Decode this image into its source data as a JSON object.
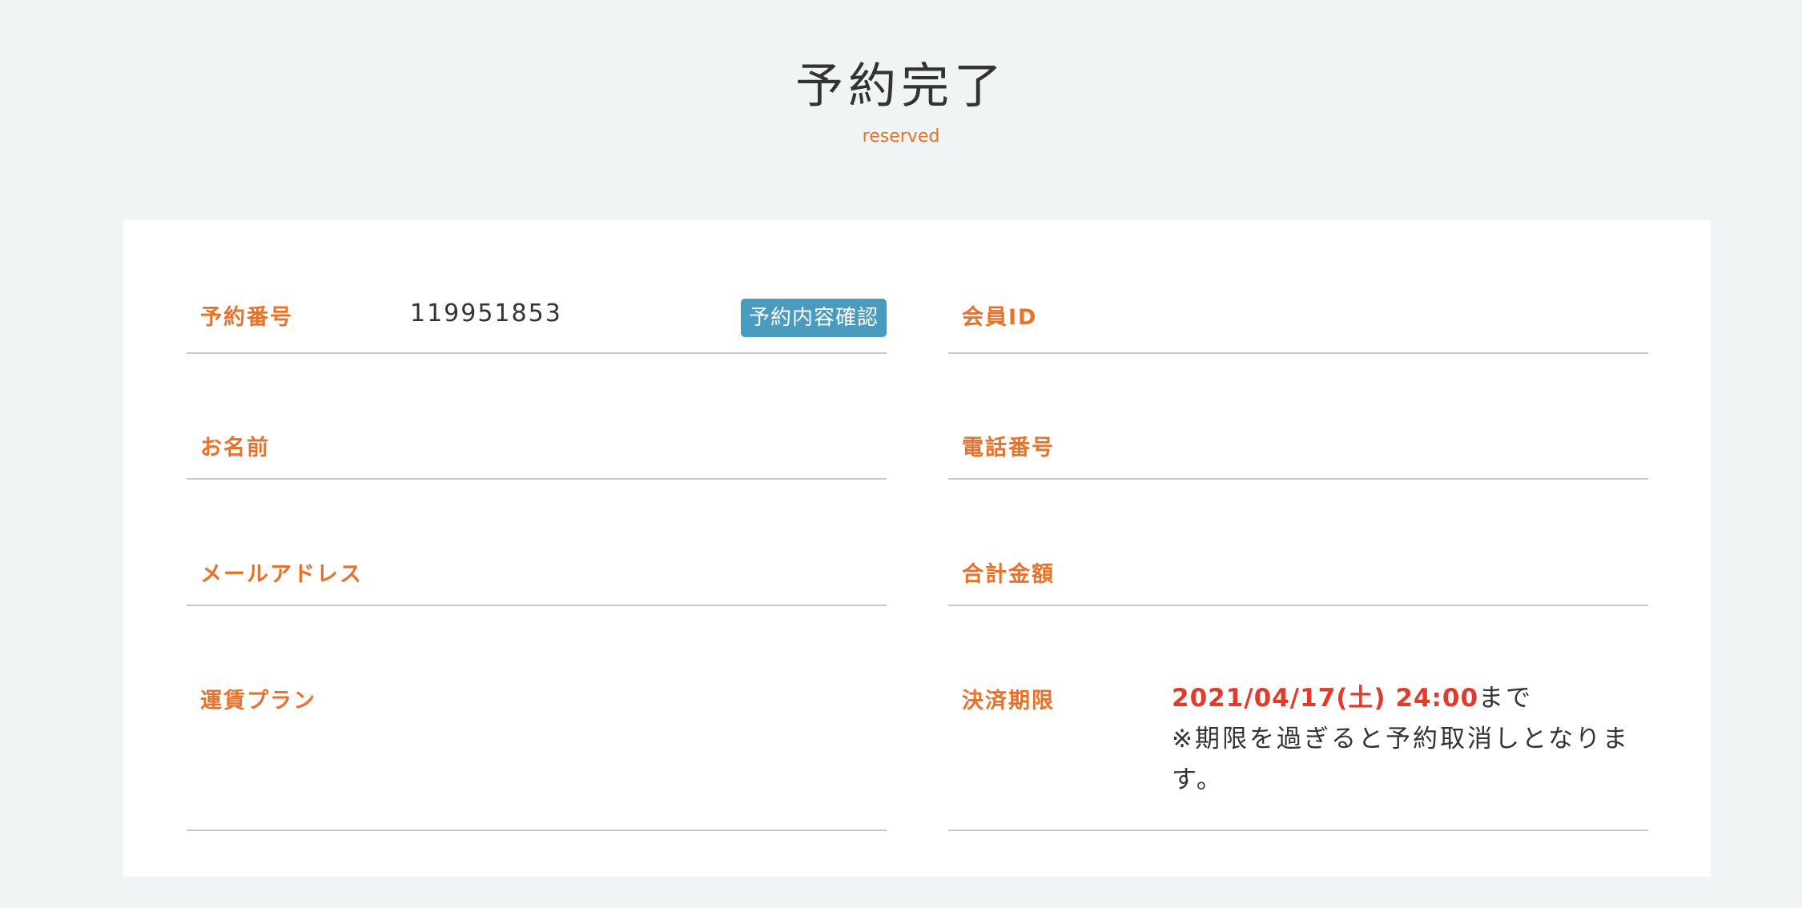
{
  "header": {
    "title": "予約完了",
    "subtitle": "reserved"
  },
  "left": {
    "reservation_number_label": "予約番号",
    "reservation_number_value": "119951853",
    "confirm_button": "予約内容確認",
    "name_label": "お名前",
    "email_label": "メールアドレス",
    "fare_plan_label": "運賃プラン"
  },
  "right": {
    "member_id_label": "会員ID",
    "phone_label": "電話番号",
    "total_label": "合計金額",
    "deadline_label": "決済期限",
    "deadline_date": "2021/04/17(土) 24:00",
    "deadline_suffix": "まで",
    "deadline_note": "※期限を過ぎると予約取消しとなります。"
  },
  "colors": {
    "accent": "#e8712b",
    "button": "#4a9cbf",
    "deadline": "#e33b2b"
  }
}
